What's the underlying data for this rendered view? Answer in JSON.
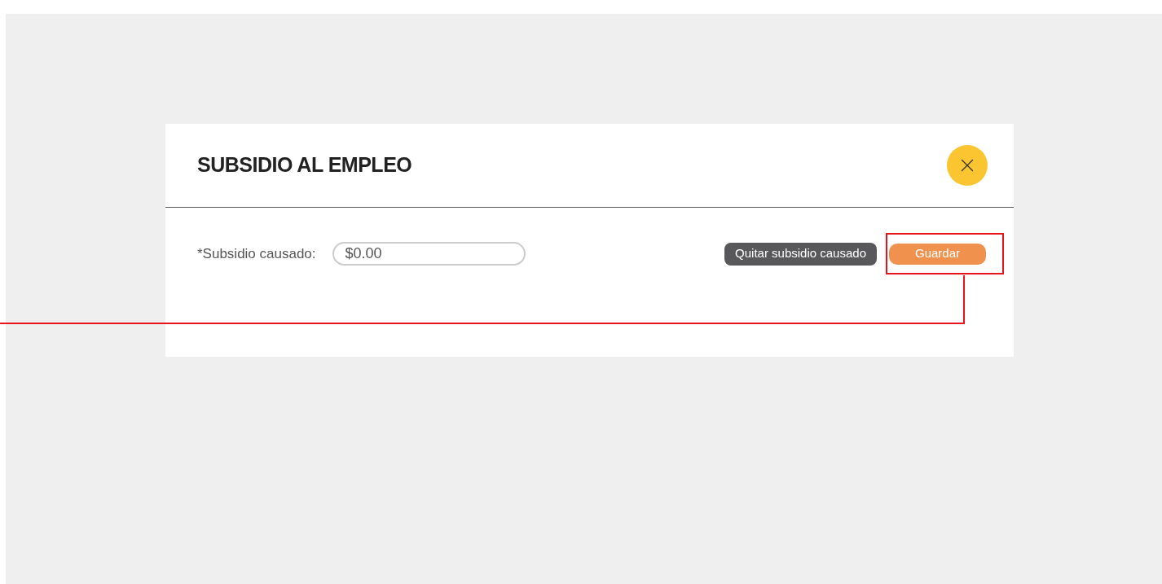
{
  "dialog": {
    "title": "SUBSIDIO AL EMPLEO",
    "field": {
      "label": "*Subsidio causado:",
      "value": "$0.00"
    },
    "buttons": [
      {
        "kind": "secondary",
        "label": "Quitar subsidio causado",
        "highlighted": false
      },
      {
        "kind": "primary",
        "label": "Guardar",
        "highlighted": true
      }
    ]
  }
}
